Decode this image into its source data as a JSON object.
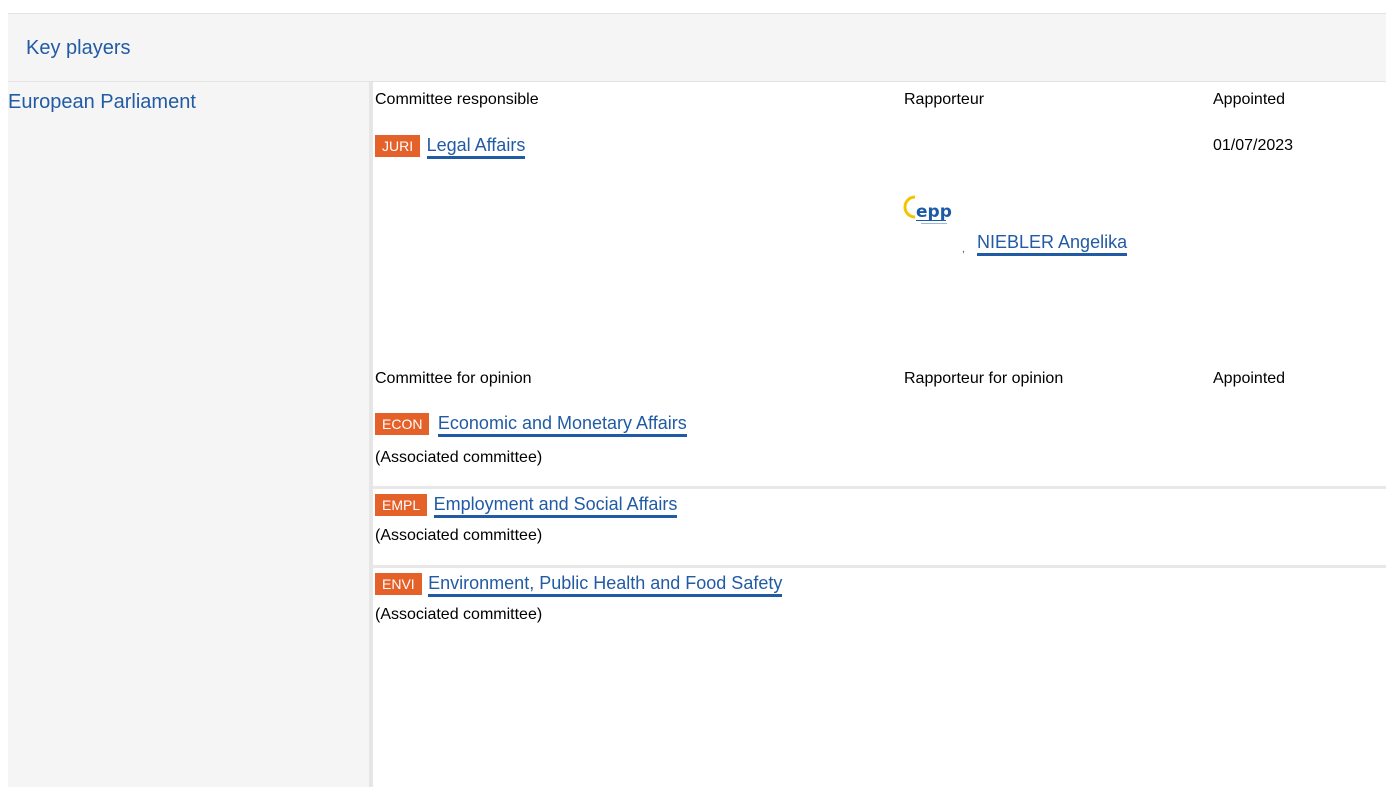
{
  "section": {
    "title": "Key players"
  },
  "institution": {
    "name": "European Parliament"
  },
  "responsible": {
    "col_committee": "Committee responsible",
    "col_rapporteur": "Rapporteur",
    "col_appointed": "Appointed",
    "committee": {
      "code": "JURI",
      "name": "Legal Affairs"
    },
    "rapporteur": {
      "name": "NIEBLER Angelika",
      "group_logo_text": "epp"
    },
    "appointed": "01/07/2023"
  },
  "opinion": {
    "col_committee": "Committee for opinion",
    "col_rapporteur": "Rapporteur for opinion",
    "col_appointed": "Appointed",
    "committees": [
      {
        "code": "ECON",
        "name": "Economic and Monetary Affairs",
        "note": "(Associated committee)"
      },
      {
        "code": "EMPL",
        "name": "Employment and Social Affairs",
        "note": "(Associated committee)"
      },
      {
        "code": "ENVI",
        "name": "Environment, Public Health and Food Safety",
        "note": "(Associated committee)"
      }
    ]
  },
  "colors": {
    "link": "#215ba4",
    "badge": "#e4612a",
    "header_bg": "#f5f5f5"
  }
}
